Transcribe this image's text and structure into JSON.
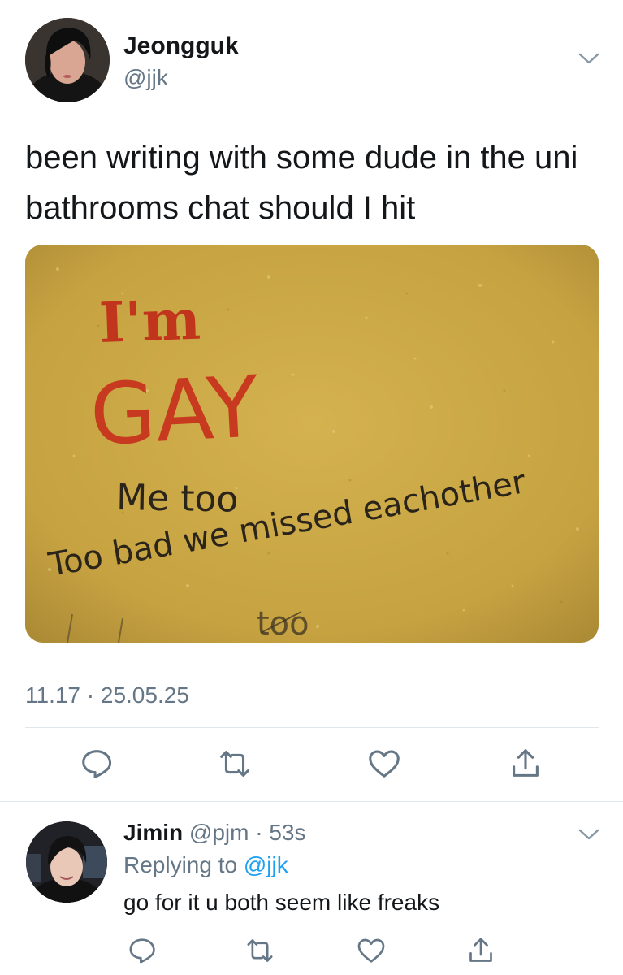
{
  "tweet": {
    "author": {
      "name": "Jeongguk",
      "handle": "@jjk"
    },
    "text": "been writing with some dude in the uni bathrooms chat should I hit",
    "image_text": {
      "line1": "I'm",
      "line2": "GAY",
      "line3": "Me too",
      "line4": "Too bad we missed eachother",
      "line5": "too"
    },
    "timestamp": "11.17 · 25.05.25"
  },
  "reply": {
    "author": {
      "name": "Jimin",
      "handle": "@pjm",
      "time": "· 53s"
    },
    "replying_to_prefix": "Replying to",
    "replying_to_handle": "@jjk",
    "text": "go for it u both seem like freaks"
  },
  "icons": {
    "reply": "reply-icon",
    "retweet": "retweet-icon",
    "like": "heart-icon",
    "share": "share-icon",
    "more": "chevron-down-icon"
  },
  "colors": {
    "text_primary": "#14171a",
    "text_secondary": "#657786",
    "link": "#1da1f2",
    "divider": "#e1e8ed",
    "wall": "#c9a64a",
    "marker_red": "#c2351d"
  }
}
